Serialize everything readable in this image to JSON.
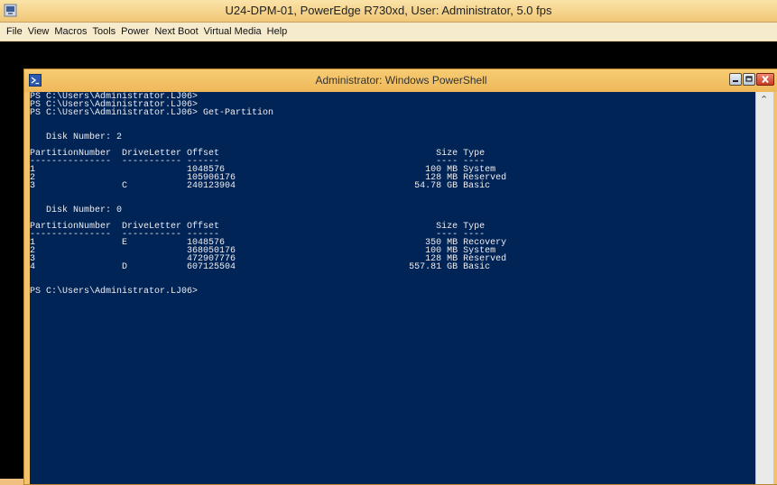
{
  "viewer": {
    "title": "U24-DPM-01, PowerEdge R730xd, User: Administrator, 5.0 fps",
    "menu": [
      "File",
      "View",
      "Macros",
      "Tools",
      "Power",
      "Next Boot",
      "Virtual Media",
      "Help"
    ]
  },
  "powershell": {
    "title": "Administrator: Windows PowerShell",
    "lines": [
      "PS C:\\Users\\Administrator.LJ06>",
      "PS C:\\Users\\Administrator.LJ06>",
      "PS C:\\Users\\Administrator.LJ06> Get-Partition",
      "",
      "",
      "   Disk Number: 2",
      "",
      "PartitionNumber  DriveLetter Offset                                        Size Type",
      "---------------  ----------- ------                                        ---- ----",
      "1                            1048576                                     100 MB System",
      "2                            105906176                                   128 MB Reserved",
      "3                C           240123904                                 54.78 GB Basic",
      "",
      "",
      "   Disk Number: 0",
      "",
      "PartitionNumber  DriveLetter Offset                                        Size Type",
      "---------------  ----------- ------                                        ---- ----",
      "1                E           1048576                                     350 MB Recovery",
      "2                            368050176                                   100 MB System",
      "3                            472907776                                   128 MB Reserved",
      "4                D           607125504                                557.81 GB Basic",
      "",
      "",
      "PS C:\\Users\\Administrator.LJ06>"
    ]
  },
  "colors": {
    "console_bg": "#012456",
    "console_fg": "#eeedf0",
    "frame": "#f2c36c"
  },
  "icons": [
    "viewer-app-icon",
    "powershell-icon",
    "minimize-icon",
    "maximize-icon",
    "close-icon",
    "scroll-up-icon"
  ]
}
